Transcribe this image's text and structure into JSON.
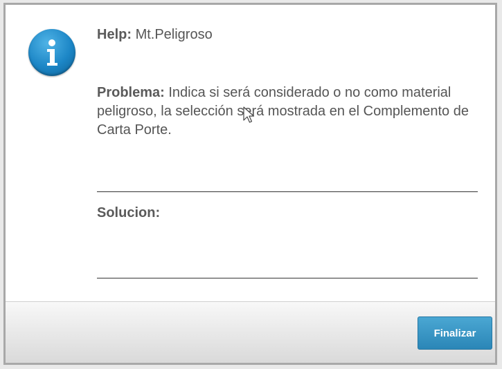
{
  "dialog": {
    "help_label": "Help:",
    "help_value": "Mt.Peligroso",
    "problem_label": "Problema:",
    "problem_text": "Indica si será considerado o no como material peligroso, la selección será mostrada en el Complemento de Carta Porte.",
    "solution_label": "Solucion:",
    "solution_text": "",
    "finish_button": "Finalizar"
  },
  "icons": {
    "info": "info-icon",
    "cursor": "mouse-pointer-icon"
  },
  "colors": {
    "button": "#2f8fc2",
    "icon": "#1c86c6"
  }
}
